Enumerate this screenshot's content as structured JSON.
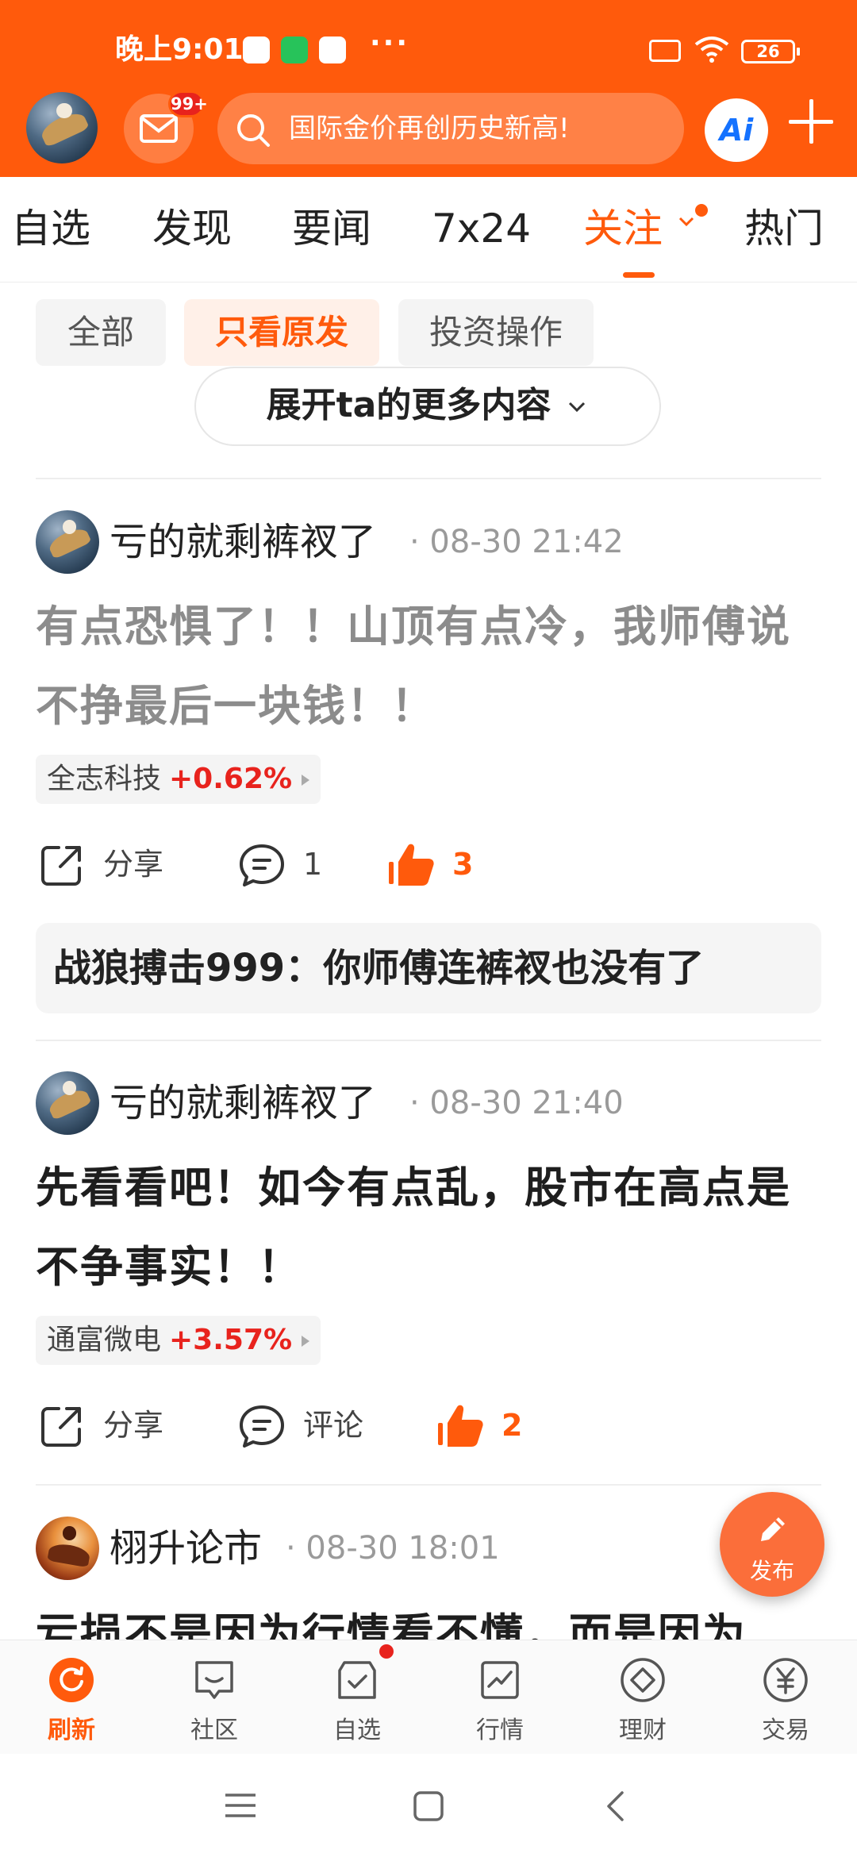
{
  "status_bar": {
    "time": "晚上9:01",
    "dots": "···",
    "battery": "26"
  },
  "header": {
    "mail_badge": "99+",
    "search_placeholder": "国际金价再创历史新高!",
    "ai_label": "Ai",
    "accent_color": "#ff5a0c"
  },
  "tabs": [
    {
      "label": "自选"
    },
    {
      "label": "发现"
    },
    {
      "label": "要闻"
    },
    {
      "label": "7x24"
    },
    {
      "label": "关注",
      "active": true
    },
    {
      "label": "热门"
    }
  ],
  "filters": [
    {
      "label": "全部"
    },
    {
      "label": "只看原发",
      "selected": true
    },
    {
      "label": "投资操作"
    }
  ],
  "expand_label": "展开ta的更多内容",
  "posts": [
    {
      "author": "亏的就剩裤衩了",
      "time": "· 08-30 21:42",
      "text": "有点恐惧了！！山顶有点冷，我师傅说不挣最后一块钱！！",
      "stock_name": "全志科技",
      "stock_change": "+0.62%",
      "share_label": "分享",
      "comment_label": "1",
      "likes": "3",
      "reply_user": "战狼搏击999",
      "reply_text": "：你师傅连裤衩也没有了"
    },
    {
      "author": "亏的就剩裤衩了",
      "time": "· 08-30 21:40",
      "text": "先看看吧！如今有点乱，股市在高点是不争事实！！",
      "stock_name": "通富微电",
      "stock_change": "+3.57%",
      "share_label": "分享",
      "comment_label": "评论",
      "likes": "2"
    },
    {
      "author": "栩升论市",
      "time": "· 08-30 18:01",
      "text": "亏损不是因为行情看不懂，而是因为"
    }
  ],
  "fab_label": "发布",
  "bottom_nav": [
    {
      "label": "刷新",
      "icon": "refresh-icon",
      "active": true
    },
    {
      "label": "社区",
      "icon": "community-icon"
    },
    {
      "label": "自选",
      "icon": "watchlist-icon"
    },
    {
      "label": "行情",
      "icon": "market-icon"
    },
    {
      "label": "理财",
      "icon": "wealth-icon"
    },
    {
      "label": "交易",
      "icon": "yen-icon"
    }
  ]
}
